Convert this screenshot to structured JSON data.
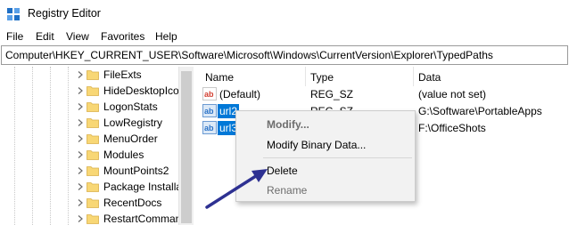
{
  "window": {
    "title": "Registry Editor"
  },
  "menu": [
    "File",
    "Edit",
    "View",
    "Favorites",
    "Help"
  ],
  "address": "Computer\\HKEY_CURRENT_USER\\Software\\Microsoft\\Windows\\CurrentVersion\\Explorer\\TypedPaths",
  "tree": {
    "items": [
      {
        "label": "FileExts"
      },
      {
        "label": "HideDesktopIco"
      },
      {
        "label": "LogonStats"
      },
      {
        "label": "LowRegistry"
      },
      {
        "label": "MenuOrder"
      },
      {
        "label": "Modules"
      },
      {
        "label": "MountPoints2"
      },
      {
        "label": "Package Installa"
      },
      {
        "label": "RecentDocs"
      },
      {
        "label": "RestartComman"
      }
    ]
  },
  "list": {
    "columns": {
      "name": "Name",
      "type": "Type",
      "data": "Data"
    },
    "rows": [
      {
        "name": "(Default)",
        "type": "REG_SZ",
        "data": "(value not set)",
        "selected": false
      },
      {
        "name": "url2",
        "type": "REG_SZ",
        "data": "G:\\Software\\PortableApps",
        "selected": true
      },
      {
        "name": "url3",
        "type": "",
        "data": "F:\\OfficeShots",
        "selected": true
      }
    ]
  },
  "context_menu": {
    "modify": "Modify...",
    "modify_binary": "Modify Binary Data...",
    "delete": "Delete",
    "rename": "Rename"
  },
  "colors": {
    "selection": "#0078d7",
    "folder": "#f8d775",
    "arrow": "#2e3192",
    "value_icon_string": "#d23f31",
    "value_icon_binary": "#2a72c7"
  },
  "icons": {
    "app": "registry-editor-icon",
    "folder": "folder-icon",
    "chevron": "chevron-right-icon",
    "string_value": "string-value-icon",
    "binary_value": "binary-value-icon"
  }
}
